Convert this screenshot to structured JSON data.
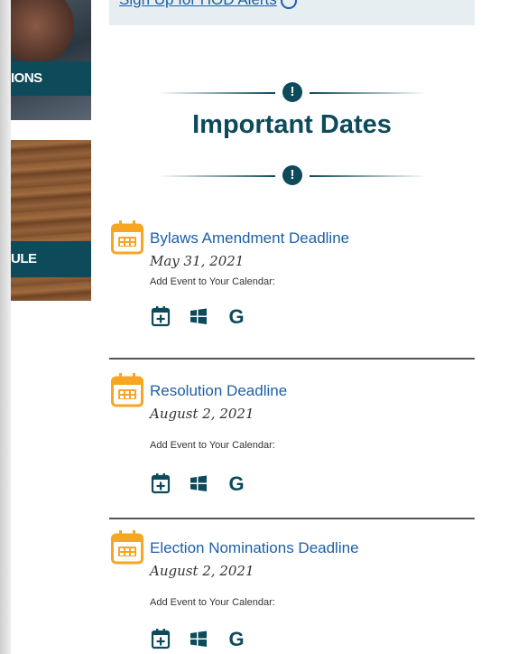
{
  "left_promos": [
    {
      "label": "IONS"
    },
    {
      "label": "ULE"
    }
  ],
  "alert": {
    "link_text": "Sign Up for HOD Alerts"
  },
  "section": {
    "title": "Important Dates"
  },
  "add_calendar_label": "Add Event to Your Calendar:",
  "calendar_link_icons": [
    "add-calendar-icon",
    "windows-icon",
    "google-icon"
  ],
  "events": [
    {
      "title": "Bylaws Amendment Deadline",
      "date": "May 31, 2021"
    },
    {
      "title": "Resolution Deadline",
      "date": "August 2, 2021"
    },
    {
      "title": "Election Nominations Deadline",
      "date": "August 2, 2021"
    }
  ],
  "colors": {
    "accent_teal": "#0d4a5a",
    "link_blue": "#1d5fa8",
    "calendar_orange": "#f6a623"
  }
}
